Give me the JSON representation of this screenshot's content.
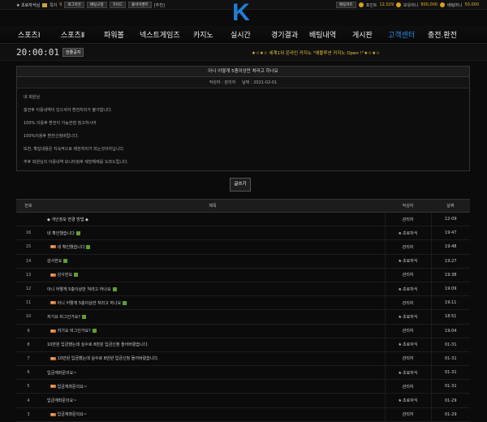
{
  "topbar": {
    "user": "★ 초로자식님",
    "points_label": "쪽지",
    "points_value": "0",
    "buttons": [
      "로그아웃",
      "배팅규정",
      "가이드",
      "출석이벤트"
    ],
    "recommend": "[추천]",
    "bet_cart": "배팅카트",
    "point_label": "포인트",
    "point_value": "12,029",
    "holding_label": "보유머니",
    "holding_value": "800,000",
    "betting_label": "배팅머니",
    "betting_value": "50,000"
  },
  "logo": "K",
  "nav": {
    "items": [
      "스포츠Ⅰ",
      "스포츠Ⅱ",
      "파워볼",
      "넥스트게임즈",
      "카지노",
      "실시간",
      "경기결과",
      "배팅내역",
      "게시판",
      "고객센터",
      "충전.환전"
    ],
    "active_index": 9,
    "active_color": "#2d8ee6"
  },
  "ticker": {
    "clock": "20:00:01",
    "notice_button": "한줄공지",
    "marquee": "★☆★☆ 세계1위 온라인 카지노 \"에볼루션 카지노 Open !\"★☆★☆"
  },
  "post": {
    "title": "아니 어떻게 5충이상만 쳐라고 하나요",
    "writer_label": "작성자",
    "writer": "관리자",
    "date_label": "날짜",
    "date": "2021-02-01",
    "lines": [
      "네 회원님",
      "충전후 이용내역이 있으셔야 환전처리가 불가합니다.",
      "100% 이용후 환전이 가능한점 참고하시어",
      "100%이용후 환전신청바랍니다.",
      "또한, 확답내용은 지속적으로 제한처리가 되는것이아닙니다.",
      "추후 회원님의 이용내역 모니터링후 제한해제를 도와드립니다."
    ]
  },
  "write_button": "글쓰기",
  "board": {
    "headers": [
      "번호",
      "제목",
      "작성자",
      "날짜"
    ],
    "rows": [
      {
        "num": "",
        "title": "◆ 개인정보 변경 방법 ◆",
        "reply": false,
        "new": false,
        "writer": "관리자",
        "star": false,
        "date": "12-09"
      },
      {
        "num": "16",
        "title": "네 확인했습니다",
        "reply": false,
        "new": true,
        "writer": "초로자식",
        "star": true,
        "date": "19:47"
      },
      {
        "num": "15",
        "title": "네 확인했습니다",
        "reply": true,
        "new": true,
        "writer": "관리자",
        "star": false,
        "date": "19:48"
      },
      {
        "num": "14",
        "title": "감사한요",
        "reply": false,
        "new": true,
        "writer": "초로자식",
        "star": true,
        "date": "19:27"
      },
      {
        "num": "13",
        "title": "감사한요",
        "reply": true,
        "new": true,
        "writer": "관리자",
        "star": false,
        "date": "19:38"
      },
      {
        "num": "12",
        "title": "아니 어떻게 5충이상만 쳐라고 하나요",
        "reply": false,
        "new": true,
        "writer": "초로자식",
        "star": true,
        "date": "19:09"
      },
      {
        "num": "11",
        "title": "아니 어떻게 5충이상만 쳐라고 하나요",
        "reply": true,
        "new": true,
        "writer": "관리자",
        "star": false,
        "date": "19:11"
      },
      {
        "num": "10",
        "title": "저기요 비그인가요?",
        "reply": false,
        "new": true,
        "writer": "초로자식",
        "star": true,
        "date": "18:51"
      },
      {
        "num": "9",
        "title": "저기요 비그인가요?",
        "reply": true,
        "new": true,
        "writer": "관리자",
        "star": false,
        "date": "19:04"
      },
      {
        "num": "8",
        "title": "10만원 입금했는데 실수로 8만원 입금신청 들어버렸습니다.",
        "reply": false,
        "new": false,
        "writer": "초로자식",
        "star": true,
        "date": "01-31"
      },
      {
        "num": "7",
        "title": "10만원 입금했는데 실수로 8만원 입금신청 들어버렸습니다.",
        "reply": true,
        "new": false,
        "writer": "관리자",
        "star": false,
        "date": "01-31"
      },
      {
        "num": "6",
        "title": "입금계좌문의요~",
        "reply": false,
        "new": false,
        "writer": "초로자식",
        "star": true,
        "date": "01-31"
      },
      {
        "num": "5",
        "title": "입금계좌문의요~",
        "reply": true,
        "new": false,
        "writer": "관리자",
        "star": false,
        "date": "01-31"
      },
      {
        "num": "4",
        "title": "입금계좌문의요~",
        "reply": false,
        "new": false,
        "writer": "초로자식",
        "star": true,
        "date": "01-29"
      },
      {
        "num": "3",
        "title": "입금계좌문의요~",
        "reply": true,
        "new": false,
        "writer": "관리자",
        "star": false,
        "date": "01-29"
      }
    ]
  }
}
